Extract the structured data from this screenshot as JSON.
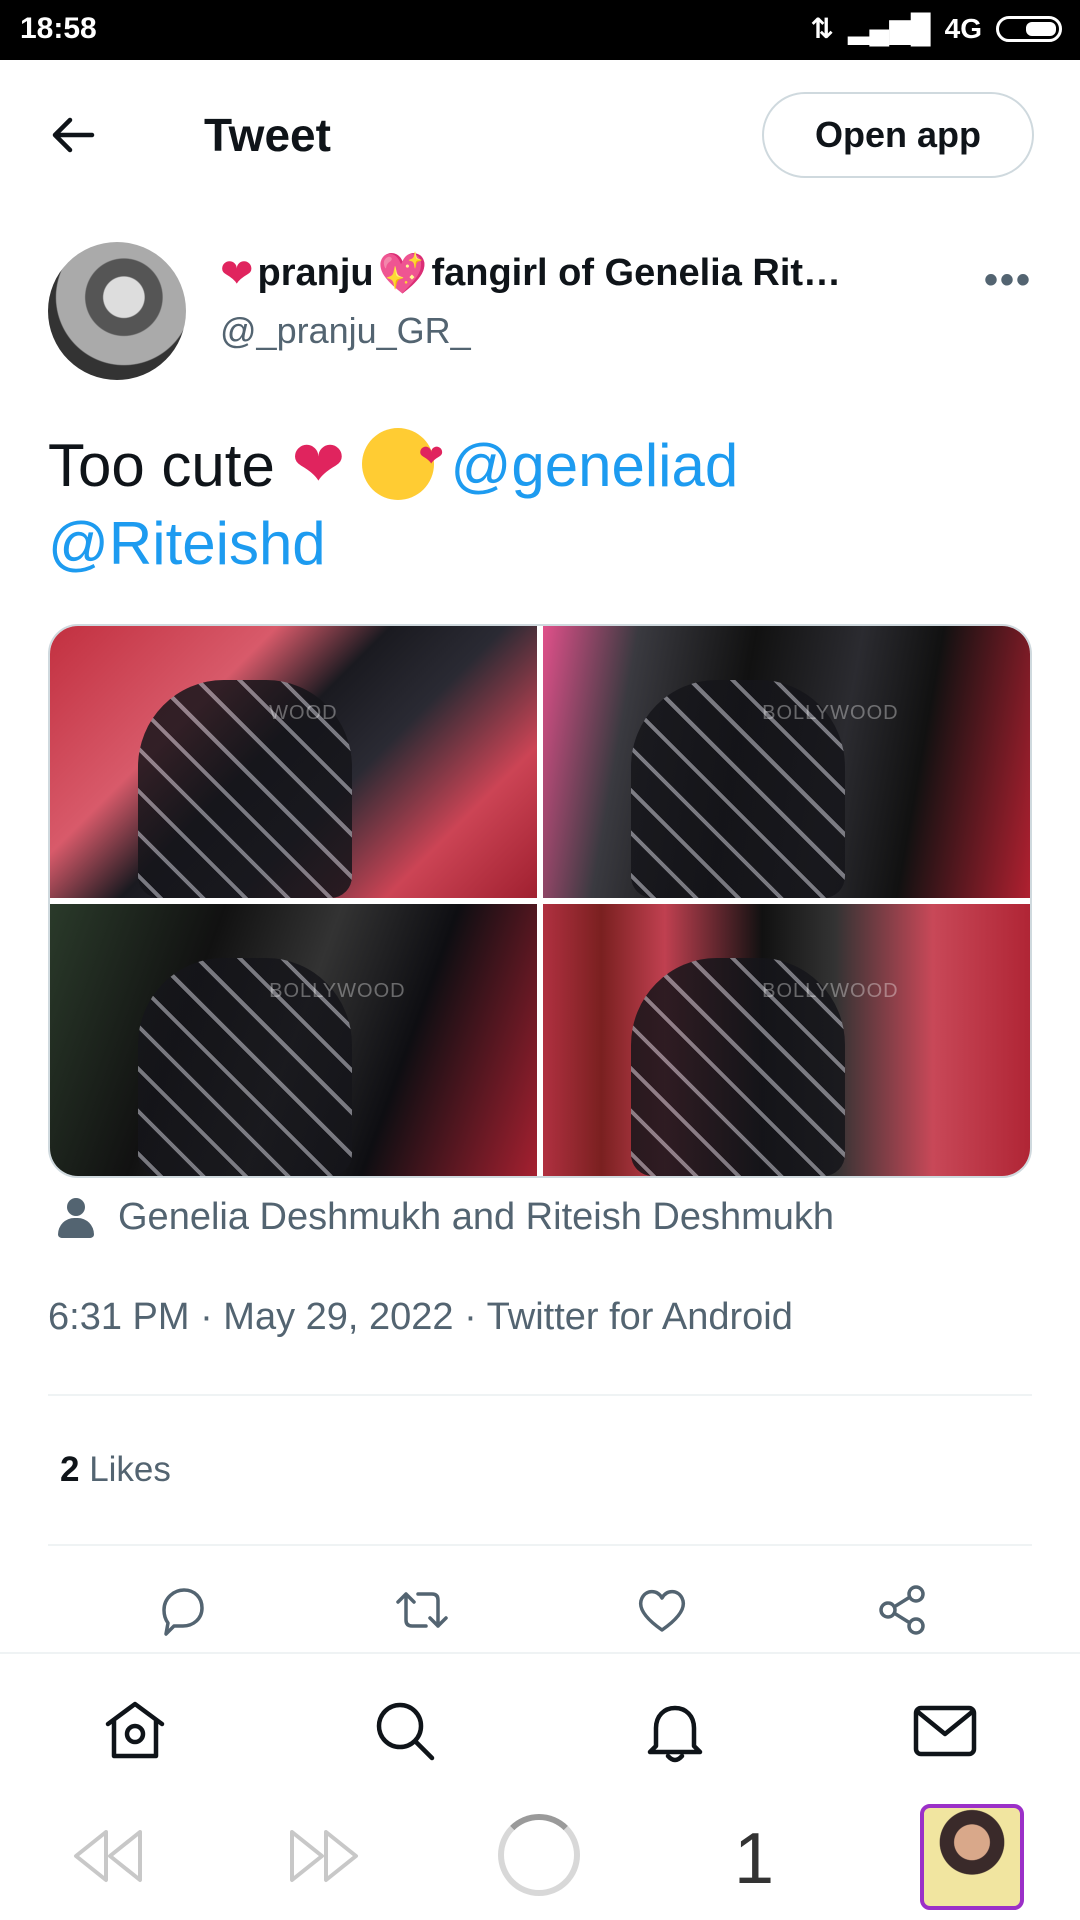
{
  "status_bar": {
    "time": "18:58",
    "network": "4G"
  },
  "header": {
    "title": "Tweet",
    "open_app": "Open app"
  },
  "author": {
    "name_part1": "pranju",
    "name_part2": "fangirl of Genelia Rit…",
    "handle": "@_pranju_GR_",
    "more": "•••"
  },
  "tweet": {
    "text": "Too cute ",
    "mention1": "@geneliad",
    "mention2": "@Riteishd"
  },
  "media": {
    "watermarks": [
      "WOOD",
      "BOLLYWOOD",
      "BOLLYWOOD",
      "BOLLYWOOD"
    ]
  },
  "tagged": "Genelia Deshmukh and Riteish Deshmukh",
  "meta": "6:31 PM · May 29, 2022 · Twitter for Android",
  "likes": {
    "count": "2",
    "label": " Likes"
  },
  "actions": [
    "reply-icon",
    "retweet-icon",
    "like-icon",
    "share-icon"
  ],
  "tabs": [
    "home-icon",
    "search-icon",
    "notifications-icon",
    "messages-icon"
  ],
  "browser": {
    "tab_count": "1"
  },
  "colors": {
    "accent": "#1d9bf0",
    "text": "#0f1419",
    "secondary": "#536471",
    "heart": "#e0245e"
  }
}
